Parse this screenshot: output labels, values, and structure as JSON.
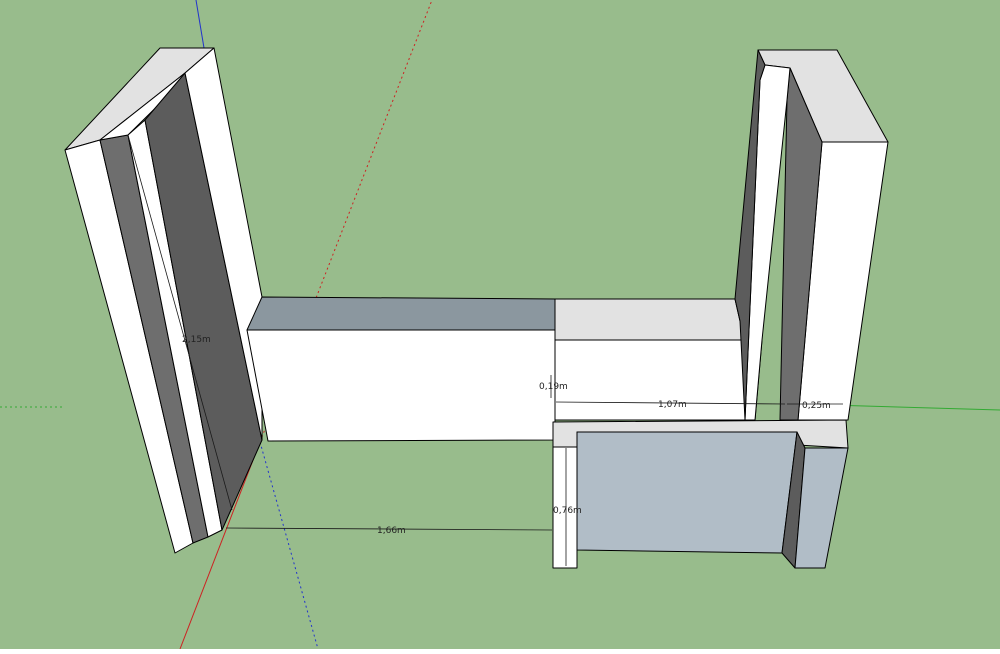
{
  "viewport": {
    "background": "#98bc8c",
    "colors": {
      "face_light": "#ffffff",
      "face_mid": "#e2e2e2",
      "face_shadow": "#6e6e6e",
      "face_dark": "#5c5c5c",
      "face_blue_top": "#8b979f",
      "face_blue_front": "#b1bdc7",
      "axis_red": "#cc2222",
      "axis_green": "#33aa33",
      "axis_blue": "#2233cc"
    },
    "dimensions": [
      {
        "id": "height-left-wall",
        "label": "2,15m"
      },
      {
        "id": "length-bottom",
        "label": "1,66m"
      },
      {
        "id": "thickness-middle",
        "label": "0,19m"
      },
      {
        "id": "length-right-shelf",
        "label": "1,07m"
      },
      {
        "id": "width-right",
        "label": "0,25m"
      },
      {
        "id": "height-low-block",
        "label": "0,76m"
      }
    ]
  }
}
